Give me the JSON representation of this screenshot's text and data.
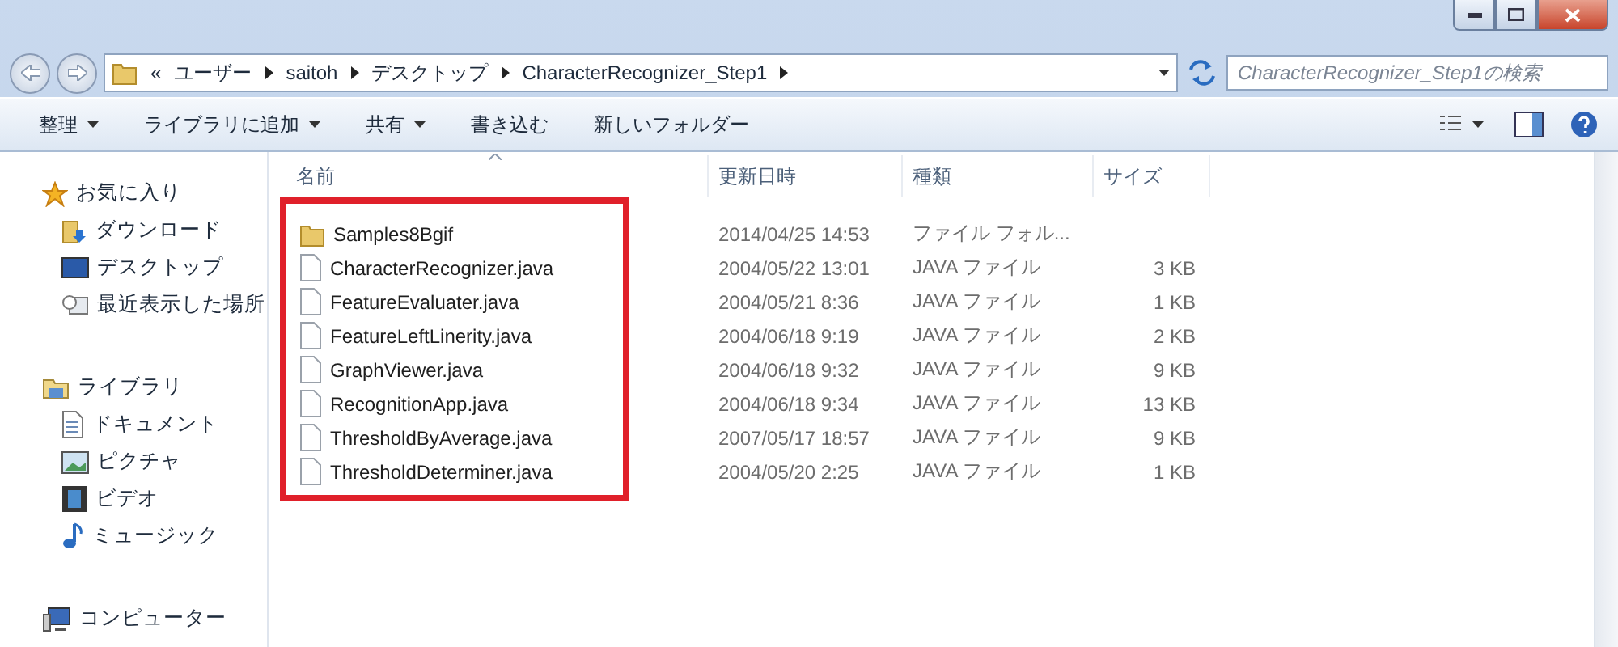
{
  "window": {
    "controls": [
      {
        "kind": "minimize"
      },
      {
        "kind": "maximize"
      },
      {
        "kind": "close"
      }
    ]
  },
  "address_bar": {
    "overflow": "«",
    "path": [
      "ユーザー",
      "saitoh",
      "デスクトップ",
      "CharacterRecognizer_Step1"
    ]
  },
  "search": {
    "placeholder": "CharacterRecognizer_Step1の検索"
  },
  "toolbar": {
    "buttons": [
      {
        "label": "整理",
        "dropdown": true
      },
      {
        "label": "ライブラリに追加",
        "dropdown": true
      },
      {
        "label": "共有",
        "dropdown": true
      },
      {
        "label": "書き込む",
        "dropdown": false
      },
      {
        "label": "新しいフォルダー",
        "dropdown": false
      }
    ]
  },
  "sidebar": {
    "groups": [
      {
        "label": "お気に入り",
        "kind": "favorites",
        "children": [
          {
            "label": "ダウンロード",
            "kind": "downloads"
          },
          {
            "label": "デスクトップ",
            "kind": "desktop"
          },
          {
            "label": "最近表示した場所",
            "kind": "recent"
          }
        ]
      },
      {
        "label": "ライブラリ",
        "kind": "libraries",
        "children": [
          {
            "label": "ドキュメント",
            "kind": "documents"
          },
          {
            "label": "ピクチャ",
            "kind": "pictures"
          },
          {
            "label": "ビデオ",
            "kind": "videos"
          },
          {
            "label": "ミュージック",
            "kind": "music"
          }
        ]
      },
      {
        "label": "コンピューター",
        "kind": "computer"
      }
    ]
  },
  "table": {
    "columns": [
      {
        "label": "名前",
        "sorted": true
      },
      {
        "label": "更新日時",
        "sorted": false
      },
      {
        "label": "種類",
        "sorted": false
      },
      {
        "label": "サイズ",
        "sorted": false
      }
    ],
    "rows": [
      {
        "kind": "folder",
        "name": "Samples8Bgif",
        "modified": "2014/04/25 14:53",
        "type": "ファイル フォル...",
        "size": ""
      },
      {
        "kind": "file",
        "name": "CharacterRecognizer.java",
        "modified": "2004/05/22 13:01",
        "type": "JAVA ファイル",
        "size": "3 KB"
      },
      {
        "kind": "file",
        "name": "FeatureEvaluater.java",
        "modified": "2004/05/21 8:36",
        "type": "JAVA ファイル",
        "size": "1 KB"
      },
      {
        "kind": "file",
        "name": "FeatureLeftLinerity.java",
        "modified": "2004/06/18 9:19",
        "type": "JAVA ファイル",
        "size": "2 KB"
      },
      {
        "kind": "file",
        "name": "GraphViewer.java",
        "modified": "2004/06/18 9:32",
        "type": "JAVA ファイル",
        "size": "9 KB"
      },
      {
        "kind": "file",
        "name": "RecognitionApp.java",
        "modified": "2004/06/18 9:34",
        "type": "JAVA ファイル",
        "size": "13 KB"
      },
      {
        "kind": "file",
        "name": "ThresholdByAverage.java",
        "modified": "2007/05/17 18:57",
        "type": "JAVA ファイル",
        "size": "9 KB"
      },
      {
        "kind": "file",
        "name": "ThresholdDeterminer.java",
        "modified": "2004/05/20 2:25",
        "type": "JAVA ファイル",
        "size": "1 KB"
      }
    ]
  },
  "highlight": {
    "color": "#e0202a"
  }
}
